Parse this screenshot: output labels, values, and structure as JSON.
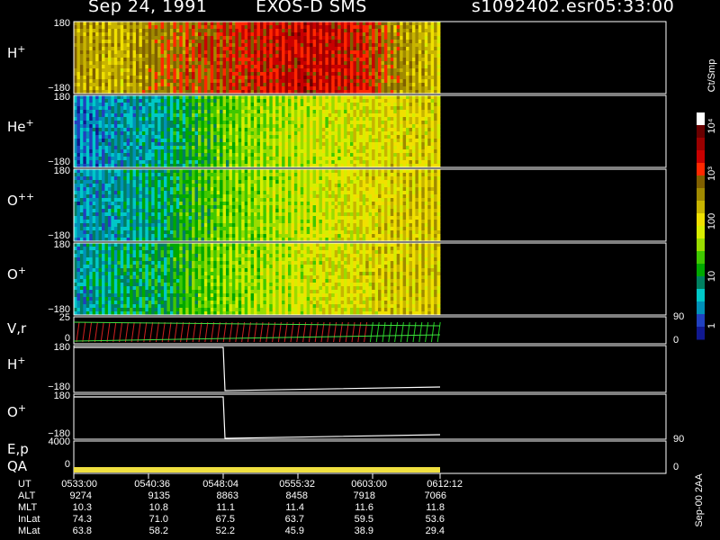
{
  "header": {
    "date": "Sep 24, 1991",
    "mission": "EXOS-D SMS",
    "file": "s1092402.esr",
    "time": "05:33:00"
  },
  "colorbar": {
    "unit_label": "Ct/Smp",
    "tick_labels": [
      "10⁴",
      "10³",
      "100",
      "10",
      "1"
    ],
    "colors": [
      "#ffffff",
      "#6a0000",
      "#9a0000",
      "#c80000",
      "#ff2800",
      "#806000",
      "#a08a00",
      "#c8b400",
      "#f0e000",
      "#d8ee00",
      "#9adc00",
      "#40c800",
      "#00a800",
      "#008060",
      "#00c8c8",
      "#0090b8",
      "#2040c0",
      "#101890"
    ]
  },
  "panels": [
    {
      "label": "H",
      "sup": "+",
      "ymax": "180",
      "ymin": "−180"
    },
    {
      "label": "He",
      "sup": "+",
      "ymax": "180",
      "ymin": "−180"
    },
    {
      "label": "O",
      "sup": "++",
      "ymax": "180",
      "ymin": "−180"
    },
    {
      "label": "O",
      "sup": "+",
      "ymax": "180",
      "ymin": "−180"
    }
  ],
  "vr_panel": {
    "label": "V,r",
    "left_top": "25",
    "left_bottom": "0",
    "right_top": "90",
    "right_bottom": "0"
  },
  "h_pitch": {
    "label": "H",
    "sup": "+",
    "ymax": "180",
    "ymin": "−180"
  },
  "o_pitch": {
    "label": "O",
    "sup": "+",
    "ymax": "180",
    "ymin": "−180"
  },
  "ep_panel": {
    "label": "E,p",
    "left_top": "4000",
    "right_top": "90"
  },
  "qa_panel": {
    "label": "QA",
    "left_bottom": "0",
    "right_bottom": "0"
  },
  "side_note": "Sep-00 2AA",
  "table": {
    "rows": [
      {
        "label": "UT",
        "values": [
          "0533:00",
          "0540:36",
          "0548:04",
          "0555:32",
          "0603:00",
          "0612:12"
        ]
      },
      {
        "label": "ALT",
        "values": [
          "9274",
          "9135",
          "8863",
          "8458",
          "7918",
          "7066"
        ]
      },
      {
        "label": "MLT",
        "values": [
          "10.3",
          "10.8",
          "11.1",
          "11.4",
          "11.6",
          "11.8"
        ]
      },
      {
        "label": "InLat",
        "values": [
          "74.3",
          "71.0",
          "67.5",
          "63.7",
          "59.5",
          "53.6"
        ]
      },
      {
        "label": "MLat",
        "values": [
          "63.8",
          "58.2",
          "52.2",
          "45.9",
          "38.9",
          "29.4"
        ]
      }
    ]
  },
  "chart_data": {
    "type": "heatmap",
    "title": "Sep 24, 1991 EXOS-D SMS",
    "xlabel": "UT",
    "x_ticks": [
      "0533:00",
      "0540:36",
      "0548:04",
      "0555:32",
      "0603:00",
      "0612:12"
    ],
    "data_end_time": "0612:12",
    "color_scale": "log",
    "color_range": [
      1,
      10000
    ],
    "series": [
      {
        "name": "H+",
        "ylim": [
          -180,
          180
        ],
        "level_profile": [
          300,
          200,
          500,
          800,
          1200,
          2000,
          1500,
          400,
          150
        ]
      },
      {
        "name": "He+",
        "ylim": [
          -180,
          180
        ],
        "level_profile": [
          2,
          4,
          6,
          20,
          40,
          60,
          80,
          120,
          150
        ]
      },
      {
        "name": "O++",
        "ylim": [
          -180,
          180
        ],
        "level_profile": [
          3,
          5,
          8,
          25,
          40,
          60,
          90,
          150,
          180
        ]
      },
      {
        "name": "O+",
        "ylim": [
          -180,
          180
        ],
        "level_profile": [
          4,
          8,
          10,
          30,
          45,
          70,
          100,
          150,
          180
        ]
      }
    ]
  }
}
